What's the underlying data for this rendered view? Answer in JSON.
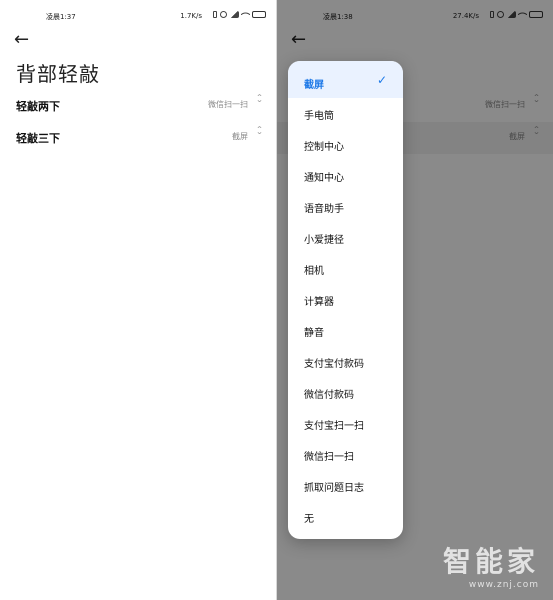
{
  "left_screen": {
    "status": {
      "time": "凌晨1:37",
      "net_speed": "1.7K/s",
      "battery_level": 0.7
    },
    "page_title": "背部轻敲",
    "settings": [
      {
        "label": "轻敲两下",
        "value": "微信扫一扫"
      },
      {
        "label": "轻敲三下",
        "value": "截屏"
      }
    ]
  },
  "right_screen": {
    "status": {
      "time": "凌晨1:38",
      "net_speed": "27.4K/s",
      "battery_level": 0.7
    },
    "background_settings": [
      {
        "value": "微信扫一扫"
      },
      {
        "value": "截屏"
      }
    ],
    "menu": {
      "selected_index": 0,
      "options": [
        "截屏",
        "手电筒",
        "控制中心",
        "通知中心",
        "语音助手",
        "小爱捷径",
        "相机",
        "计算器",
        "静音",
        "支付宝付款码",
        "微信付款码",
        "支付宝扫一扫",
        "微信扫一扫",
        "抓取问题日志",
        "无"
      ]
    }
  },
  "watermark": {
    "main": "智能家",
    "sub": "www.znj.com"
  },
  "colors": {
    "accent": "#1f7ae8",
    "battery": "#3fbf4f"
  }
}
